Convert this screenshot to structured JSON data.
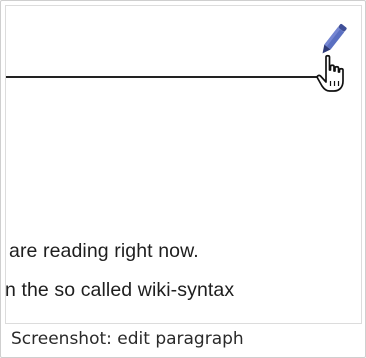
{
  "screenshot": {
    "text_lines": [
      "are reading right now.",
      "n the so called wiki-syntax"
    ],
    "icons": {
      "edit": "pencil-icon",
      "cursor": "hand-pointer-icon"
    },
    "colors": {
      "pencil": "#5a6fc1",
      "rule": "#222222",
      "text": "#1e1e1e"
    }
  },
  "caption": "Screenshot: edit paragraph"
}
